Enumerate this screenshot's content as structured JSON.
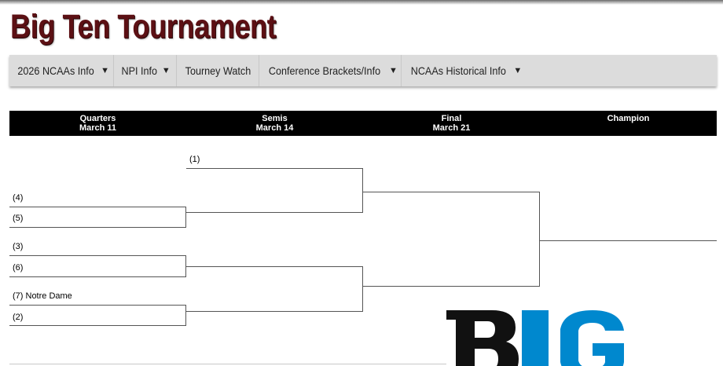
{
  "title": "Big Ten Tournament",
  "nav": [
    {
      "label": "2026 NCAAs Info",
      "dropdown": true
    },
    {
      "label": "NPI Info",
      "dropdown": true
    },
    {
      "label": "Tourney Watch",
      "dropdown": false
    },
    {
      "label": "Conference Brackets/Info",
      "dropdown": true
    },
    {
      "label": "NCAAs Historical Info",
      "dropdown": true
    }
  ],
  "caret": "▼",
  "rounds": [
    {
      "name": "Quarters",
      "date": "March 11"
    },
    {
      "name": "Semis",
      "date": "March 14"
    },
    {
      "name": "Final",
      "date": "March 21"
    },
    {
      "name": "Champion",
      "date": ""
    }
  ],
  "bracket": {
    "semis_top_seed": "(1)",
    "qf1_top": "(4)",
    "qf1_bottom": "(5)",
    "qf2_top": "(3)",
    "qf2_bottom": "(6)",
    "qf3_top": "(7) Notre Dame",
    "qf3_bottom": "(2)"
  },
  "logo": {
    "text_dark": "B",
    "text_blue": "1G",
    "color_dark": "#111111",
    "color_blue": "#0088ce"
  },
  "colors": {
    "title": "#5c1014",
    "nav_bg": "#dcdcdc",
    "header_bg": "#000000"
  }
}
